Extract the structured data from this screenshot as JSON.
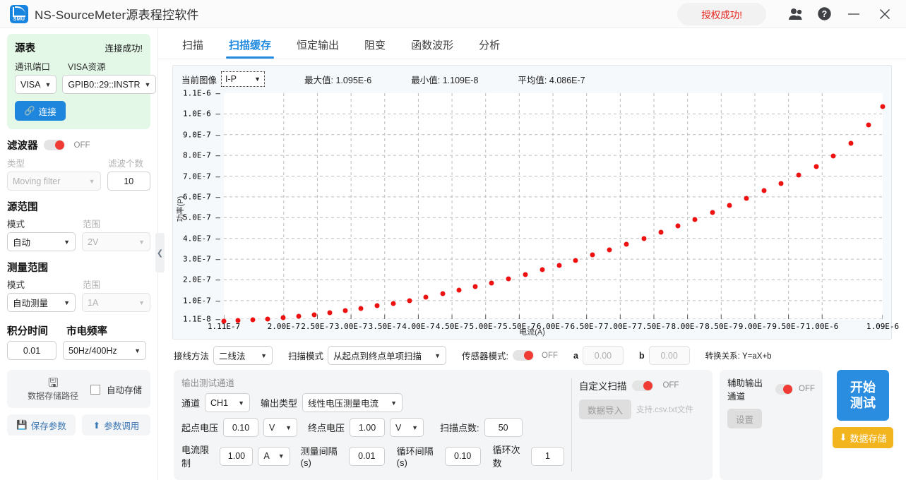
{
  "titlebar": {
    "app_title": "NS-SourceMeter源表程控软件",
    "logo_text": "SMU",
    "license_status": "授权成功!",
    "icons": {
      "users": "users-icon",
      "help": "help-icon",
      "minimize": "minimize-icon",
      "close": "close-icon"
    }
  },
  "tabs": [
    {
      "label": "扫描",
      "active": false
    },
    {
      "label": "扫描缓存",
      "active": true
    },
    {
      "label": "恒定输出",
      "active": false
    },
    {
      "label": "阻变",
      "active": false
    },
    {
      "label": "函数波形",
      "active": false
    },
    {
      "label": "分析",
      "active": false
    }
  ],
  "sidebar": {
    "source": {
      "title": "源表",
      "status": "连接成功!",
      "port_label": "通讯端口",
      "port_value": "VISA",
      "visa_label": "VISA资源",
      "visa_value": "GPIB0::29::INSTR",
      "connect_button": "连接"
    },
    "filter": {
      "title": "滤波器",
      "toggle_state": "OFF",
      "type_label": "类型",
      "type_value": "Moving filter",
      "count_label": "滤波个数",
      "count_value": "10"
    },
    "source_range": {
      "title": "源范围",
      "mode_label": "模式",
      "mode_value": "自动",
      "range_label": "范围",
      "range_value": "2V"
    },
    "measure_range": {
      "title": "测量范围",
      "mode_label": "模式",
      "mode_value": "自动测量",
      "range_label": "范围",
      "range_value": "1A"
    },
    "integration": {
      "time_label": "积分时间",
      "time_value": "0.01",
      "freq_label": "市电频率",
      "freq_value": "50Hz/400Hz"
    },
    "storage": {
      "path_button": "数据存储路径",
      "auto_save_label": "自动存储",
      "auto_save_checked": false,
      "save_params": "保存参数",
      "load_params": "参数调用"
    },
    "collapse_icon": "chevron-left-icon"
  },
  "chart_header": {
    "current_image_label": "当前图像",
    "current_image_value": "I-P",
    "max_label": "最大值:",
    "max_value": "1.095E-6",
    "min_label": "最小值:",
    "min_value": "1.109E-8",
    "avg_label": "平均值:",
    "avg_value": "4.086E-7"
  },
  "chart_data": {
    "type": "scatter",
    "title": "",
    "xlabel": "电流(A)",
    "ylabel": "功率(P)",
    "grid": true,
    "legend": "none",
    "marker_color": "#ee1111",
    "xlim": [
      1.11e-07,
      1.09e-06
    ],
    "ylim": [
      1.1e-08,
      1.1e-06
    ],
    "xticks": [
      "1.11E-7",
      "2.00E-7",
      "2.50E-7",
      "3.00E-7",
      "3.50E-7",
      "4.00E-7",
      "4.50E-7",
      "5.00E-7",
      "5.50E-7",
      "6.00E-7",
      "6.50E-7",
      "7.00E-7",
      "7.50E-7",
      "8.00E-7",
      "8.50E-7",
      "9.00E-7",
      "9.50E-7",
      "1.00E-6",
      "1.09E-6"
    ],
    "xtick_values": [
      1.11e-07,
      2e-07,
      2.5e-07,
      3e-07,
      3.5e-07,
      4e-07,
      4.5e-07,
      5e-07,
      5.5e-07,
      6e-07,
      6.5e-07,
      7e-07,
      7.5e-07,
      8e-07,
      8.5e-07,
      9e-07,
      9.5e-07,
      1e-06,
      1.09e-06
    ],
    "yticks": [
      "1.1E-6",
      "1.0E-6",
      "9.0E-7",
      "8.0E-7",
      "7.0E-7",
      "6.0E-7",
      "5.0E-7",
      "4.0E-7",
      "3.0E-7",
      "2.0E-7",
      "1.0E-7",
      "1.1E-8"
    ],
    "ytick_values": [
      1.1e-06,
      1e-06,
      9e-07,
      8e-07,
      7e-07,
      6e-07,
      5e-07,
      4e-07,
      3e-07,
      2e-07,
      1e-07,
      1.1e-08
    ],
    "x": [
      1.11e-07,
      1.32e-07,
      1.54e-07,
      1.76e-07,
      1.99e-07,
      2.22e-07,
      2.45e-07,
      2.68e-07,
      2.92e-07,
      3.15e-07,
      3.39e-07,
      3.63e-07,
      3.87e-07,
      4.11e-07,
      4.36e-07,
      4.6e-07,
      4.85e-07,
      5.09e-07,
      5.34e-07,
      5.59e-07,
      5.84e-07,
      6.09e-07,
      6.34e-07,
      6.59e-07,
      6.84e-07,
      7.09e-07,
      7.35e-07,
      7.6e-07,
      7.86e-07,
      8.11e-07,
      8.37e-07,
      8.62e-07,
      8.88e-07,
      9.14e-07,
      9.39e-07,
      9.65e-07,
      9.91e-07,
      1.017e-06,
      1.043e-06,
      1.069e-06,
      1.09e-06
    ],
    "y": [
      1.109e-08,
      1.45e-08,
      1.85e-08,
      2.35e-08,
      2.95e-08,
      3.65e-08,
      4.45e-08,
      5.35e-08,
      6.35e-08,
      7.45e-08,
      8.6e-08,
      9.9e-08,
      1.13e-07,
      1.28e-07,
      1.44e-07,
      1.61e-07,
      1.79e-07,
      1.98e-07,
      2.17e-07,
      2.38e-07,
      2.6e-07,
      2.82e-07,
      3.06e-07,
      3.31e-07,
      3.57e-07,
      3.84e-07,
      4.12e-07,
      4.42e-07,
      4.72e-07,
      5.03e-07,
      5.36e-07,
      5.7e-07,
      6.05e-07,
      6.41e-07,
      6.78e-07,
      7.17e-07,
      7.57e-07,
      8.1e-07,
      8.7e-07,
      9.6e-07,
      1.048e-06
    ]
  },
  "controls": {
    "wiring_label": "接线方法",
    "wiring_value": "二线法",
    "sweep_mode_label": "扫描模式",
    "sweep_mode_value": "从起点到终点单项扫描",
    "sensor_label": "传感器模式:",
    "sensor_toggle": "OFF",
    "a_label": "a",
    "a_value": "0.00",
    "b_label": "b",
    "b_value": "0.00",
    "relation": "转换关系: Y=aX+b"
  },
  "output_channel": {
    "caption": "输出测试通道",
    "channel_label": "通道",
    "channel_value": "CH1",
    "output_type_label": "输出类型",
    "output_type_value": "线性电压测量电流",
    "start_v_label": "起点电压",
    "start_v_value": "0.10",
    "start_v_unit": "V",
    "end_v_label": "终点电压",
    "end_v_value": "1.00",
    "end_v_unit": "V",
    "points_label": "扫描点数:",
    "points_value": "50",
    "current_limit_label": "电流限制",
    "current_limit_value": "1.00",
    "current_limit_unit": "A",
    "interval_label": "测量间隔(s)",
    "interval_value": "0.01",
    "loop_interval_label": "循环间隔(s)",
    "loop_interval_value": "0.10",
    "loop_count_label": "循环次数",
    "loop_count_value": "1"
  },
  "custom_sweep": {
    "title": "自定义扫描",
    "toggle_state": "OFF",
    "import_button": "数据导入",
    "hint": "支持.csv.txt文件"
  },
  "aux_channel": {
    "title": "辅助输出通道",
    "toggle_state": "OFF",
    "settings_button": "设置"
  },
  "actions": {
    "start_line1": "开始",
    "start_line2": "测试",
    "save_data": "数据存储"
  }
}
